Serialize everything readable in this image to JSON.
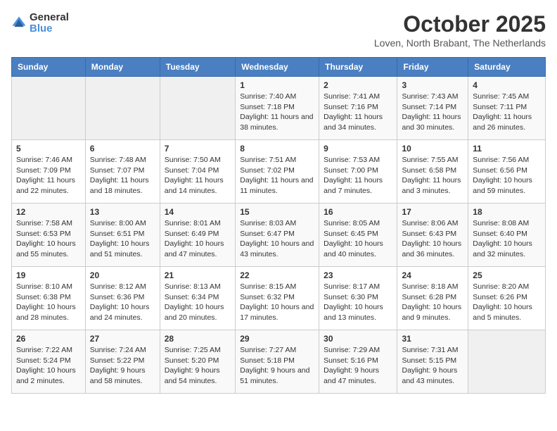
{
  "header": {
    "logo_general": "General",
    "logo_blue": "Blue",
    "title": "October 2025",
    "subtitle": "Loven, North Brabant, The Netherlands"
  },
  "days_of_week": [
    "Sunday",
    "Monday",
    "Tuesday",
    "Wednesday",
    "Thursday",
    "Friday",
    "Saturday"
  ],
  "weeks": [
    [
      {
        "day": "",
        "info": ""
      },
      {
        "day": "",
        "info": ""
      },
      {
        "day": "",
        "info": ""
      },
      {
        "day": "1",
        "info": "Sunrise: 7:40 AM\nSunset: 7:18 PM\nDaylight: 11 hours and 38 minutes."
      },
      {
        "day": "2",
        "info": "Sunrise: 7:41 AM\nSunset: 7:16 PM\nDaylight: 11 hours and 34 minutes."
      },
      {
        "day": "3",
        "info": "Sunrise: 7:43 AM\nSunset: 7:14 PM\nDaylight: 11 hours and 30 minutes."
      },
      {
        "day": "4",
        "info": "Sunrise: 7:45 AM\nSunset: 7:11 PM\nDaylight: 11 hours and 26 minutes."
      }
    ],
    [
      {
        "day": "5",
        "info": "Sunrise: 7:46 AM\nSunset: 7:09 PM\nDaylight: 11 hours and 22 minutes."
      },
      {
        "day": "6",
        "info": "Sunrise: 7:48 AM\nSunset: 7:07 PM\nDaylight: 11 hours and 18 minutes."
      },
      {
        "day": "7",
        "info": "Sunrise: 7:50 AM\nSunset: 7:04 PM\nDaylight: 11 hours and 14 minutes."
      },
      {
        "day": "8",
        "info": "Sunrise: 7:51 AM\nSunset: 7:02 PM\nDaylight: 11 hours and 11 minutes."
      },
      {
        "day": "9",
        "info": "Sunrise: 7:53 AM\nSunset: 7:00 PM\nDaylight: 11 hours and 7 minutes."
      },
      {
        "day": "10",
        "info": "Sunrise: 7:55 AM\nSunset: 6:58 PM\nDaylight: 11 hours and 3 minutes."
      },
      {
        "day": "11",
        "info": "Sunrise: 7:56 AM\nSunset: 6:56 PM\nDaylight: 10 hours and 59 minutes."
      }
    ],
    [
      {
        "day": "12",
        "info": "Sunrise: 7:58 AM\nSunset: 6:53 PM\nDaylight: 10 hours and 55 minutes."
      },
      {
        "day": "13",
        "info": "Sunrise: 8:00 AM\nSunset: 6:51 PM\nDaylight: 10 hours and 51 minutes."
      },
      {
        "day": "14",
        "info": "Sunrise: 8:01 AM\nSunset: 6:49 PM\nDaylight: 10 hours and 47 minutes."
      },
      {
        "day": "15",
        "info": "Sunrise: 8:03 AM\nSunset: 6:47 PM\nDaylight: 10 hours and 43 minutes."
      },
      {
        "day": "16",
        "info": "Sunrise: 8:05 AM\nSunset: 6:45 PM\nDaylight: 10 hours and 40 minutes."
      },
      {
        "day": "17",
        "info": "Sunrise: 8:06 AM\nSunset: 6:43 PM\nDaylight: 10 hours and 36 minutes."
      },
      {
        "day": "18",
        "info": "Sunrise: 8:08 AM\nSunset: 6:40 PM\nDaylight: 10 hours and 32 minutes."
      }
    ],
    [
      {
        "day": "19",
        "info": "Sunrise: 8:10 AM\nSunset: 6:38 PM\nDaylight: 10 hours and 28 minutes."
      },
      {
        "day": "20",
        "info": "Sunrise: 8:12 AM\nSunset: 6:36 PM\nDaylight: 10 hours and 24 minutes."
      },
      {
        "day": "21",
        "info": "Sunrise: 8:13 AM\nSunset: 6:34 PM\nDaylight: 10 hours and 20 minutes."
      },
      {
        "day": "22",
        "info": "Sunrise: 8:15 AM\nSunset: 6:32 PM\nDaylight: 10 hours and 17 minutes."
      },
      {
        "day": "23",
        "info": "Sunrise: 8:17 AM\nSunset: 6:30 PM\nDaylight: 10 hours and 13 minutes."
      },
      {
        "day": "24",
        "info": "Sunrise: 8:18 AM\nSunset: 6:28 PM\nDaylight: 10 hours and 9 minutes."
      },
      {
        "day": "25",
        "info": "Sunrise: 8:20 AM\nSunset: 6:26 PM\nDaylight: 10 hours and 5 minutes."
      }
    ],
    [
      {
        "day": "26",
        "info": "Sunrise: 7:22 AM\nSunset: 5:24 PM\nDaylight: 10 hours and 2 minutes."
      },
      {
        "day": "27",
        "info": "Sunrise: 7:24 AM\nSunset: 5:22 PM\nDaylight: 9 hours and 58 minutes."
      },
      {
        "day": "28",
        "info": "Sunrise: 7:25 AM\nSunset: 5:20 PM\nDaylight: 9 hours and 54 minutes."
      },
      {
        "day": "29",
        "info": "Sunrise: 7:27 AM\nSunset: 5:18 PM\nDaylight: 9 hours and 51 minutes."
      },
      {
        "day": "30",
        "info": "Sunrise: 7:29 AM\nSunset: 5:16 PM\nDaylight: 9 hours and 47 minutes."
      },
      {
        "day": "31",
        "info": "Sunrise: 7:31 AM\nSunset: 5:15 PM\nDaylight: 9 hours and 43 minutes."
      },
      {
        "day": "",
        "info": ""
      }
    ]
  ]
}
